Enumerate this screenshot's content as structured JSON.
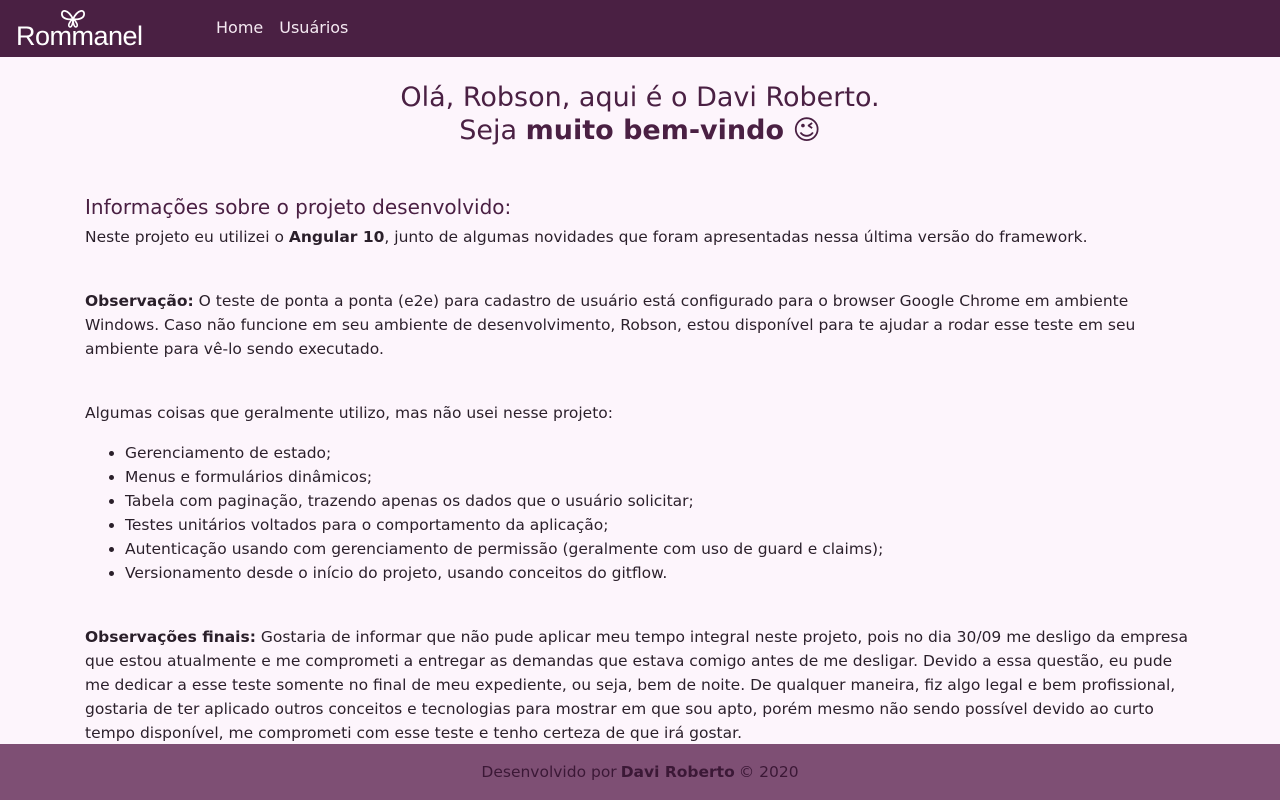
{
  "navbar": {
    "brand": "Rommanel",
    "links": [
      "Home",
      "Usuários"
    ]
  },
  "welcome": {
    "line1": "Olá, Robson, aqui é o Davi Roberto.",
    "line2_prefix": "Seja",
    "line2_bold": "muito bem-vindo",
    "line2_emoji": "😉"
  },
  "info": {
    "title": "Informações sobre o projeto desenvolvido:",
    "intro_prefix": "Neste projeto eu utilizei o",
    "intro_bold": "Angular 10",
    "intro_suffix": ", junto de algumas novidades que foram apresentadas nessa última versão do framework.",
    "obs_label": "Observação:",
    "obs_text": "O teste de ponta a ponta (e2e) para cadastro de usuário está configurado para o browser Google Chrome em ambiente Windows. Caso não funcione em seu ambiente de desenvolvimento, Robson, estou disponível para te ajudar a rodar esse teste em seu ambiente para vê-lo sendo executado.",
    "things_intro": "Algumas coisas que geralmente utilizo, mas não usei nesse projeto:",
    "things": [
      "Gerenciamento de estado;",
      "Menus e formulários dinâmicos;",
      "Tabela com paginação, trazendo apenas os dados que o usuário solicitar;",
      "Testes unitários voltados para o comportamento da aplicação;",
      "Autenticação usando com gerenciamento de permissão (geralmente com uso de guard e claims);",
      "Versionamento desde o início do projeto, usando conceitos do gitflow."
    ],
    "final_label": "Observações finais:",
    "final_text": "Gostaria de informar que não pude aplicar meu tempo integral neste projeto, pois no dia 30/09 me desligo da empresa que estou atualmente e me comprometi a entregar as demandas que estava comigo antes de me desligar. Devido a essa questão, eu pude me dedicar a esse teste somente no final de meu expediente, ou seja, bem de noite. De qualquer maneira, fiz algo legal e bem profissional, gostaria de ter aplicado outros conceitos e tecnologias para mostrar em que sou apto, porém mesmo não sendo possível devido ao curto tempo disponível, me comprometi com esse teste e tenho certeza de que irá gostar."
  },
  "footer": {
    "prefix": "Desenvolvido por",
    "author": "Davi Roberto",
    "suffix": "© 2020"
  },
  "colors": {
    "navbar": "#4a2043",
    "background": "#fdf5fc",
    "footer": "#7e4f74",
    "accent": "#4a2043"
  },
  "icons": [
    "butterfly-logo-icon",
    "wink-emoji"
  ]
}
